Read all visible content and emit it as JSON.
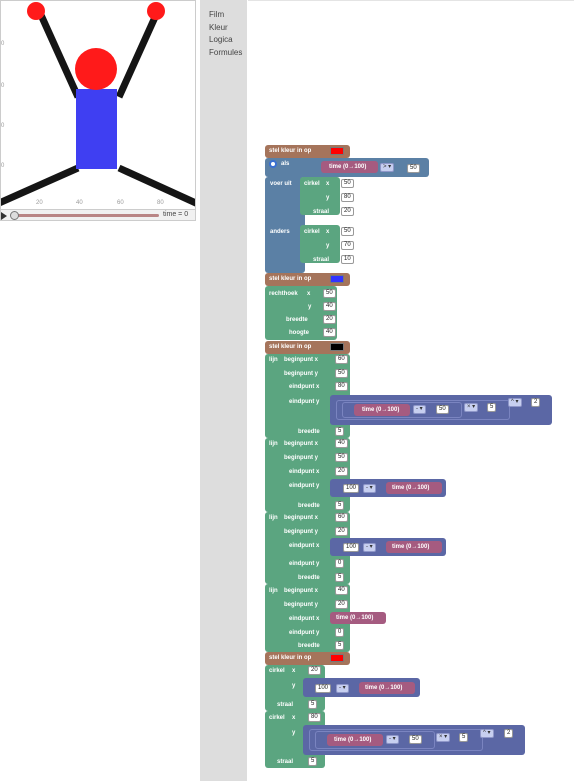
{
  "preview": {
    "y_ticks": [
      "0",
      "0",
      "0",
      "0"
    ],
    "x_ticks": [
      "20",
      "40",
      "60",
      "80"
    ],
    "time_readout": "time = 0",
    "colors": {
      "red": "#ff1a1a",
      "blue": "#3f3ff2",
      "black": "#151515"
    }
  },
  "toolbox": {
    "items": [
      "Film",
      "Kleur",
      "Logica",
      "Formules"
    ]
  },
  "labels": {
    "set_color": "stel kleur in op",
    "if": "als",
    "do": "voer uit",
    "else": "anders",
    "circle": "cirkel",
    "x": "x",
    "y": "y",
    "radius": "straal",
    "rect": "rechthoek",
    "width": "breedte",
    "height": "hoogte",
    "line": "lijn",
    "start_x": "beginpunt x",
    "start_y": "beginpunt y",
    "end_x": "eindpunt x",
    "end_y": "eindpunt y",
    "time": "time (0→100)",
    "gt": "> ▾",
    "minus": "- ▾",
    "times": "× ▾",
    "pow": "^ ▾"
  },
  "values": {
    "cond_rhs": "50",
    "if_circle_x": "50",
    "if_circle_y": "80",
    "if_circle_r": "20",
    "else_circle_x": "50",
    "else_circle_y": "70",
    "else_circle_r": "10",
    "rect_x": "50",
    "rect_y": "40",
    "rect_w": "20",
    "rect_h": "40",
    "l1_sx": "60",
    "l1_sy": "50",
    "l1_ex": "80",
    "l1_c1": "50",
    "l1_c2": "5",
    "l1_c3": "2",
    "l1_w": "5",
    "l2_sx": "40",
    "l2_sy": "50",
    "l2_ex": "20",
    "l2_c": "100",
    "l2_w": "5",
    "l3_sx": "60",
    "l3_sy": "20",
    "l3_c": "100",
    "l3_ey": "0",
    "l3_w": "5",
    "l4_sx": "40",
    "l4_sy": "20",
    "l4_ey": "0",
    "l4_w": "5",
    "c1_x": "20",
    "c1_c": "100",
    "c1_r": "5",
    "c2_x": "80",
    "c2_c1": "50",
    "c2_c2": "5",
    "c2_c3": "2",
    "c2_r": "5"
  },
  "swatches": {
    "c1": "#ff0000",
    "c2": "#3333ff",
    "c3": "#000000",
    "c4": "#ff0000"
  }
}
